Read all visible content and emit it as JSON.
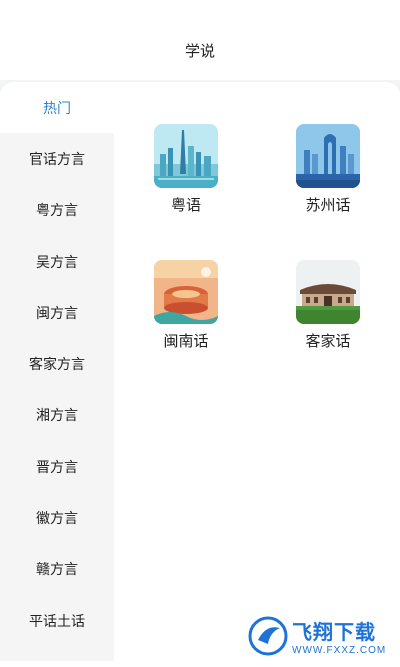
{
  "header": {
    "title": "学说"
  },
  "sidebar": {
    "items": [
      {
        "label": "热门",
        "active": true
      },
      {
        "label": "官话方言",
        "active": false
      },
      {
        "label": "粤方言",
        "active": false
      },
      {
        "label": "吴方言",
        "active": false
      },
      {
        "label": "闽方言",
        "active": false
      },
      {
        "label": "客家方言",
        "active": false
      },
      {
        "label": "湘方言",
        "active": false
      },
      {
        "label": "晋方言",
        "active": false
      },
      {
        "label": "徽方言",
        "active": false
      },
      {
        "label": "赣方言",
        "active": false
      },
      {
        "label": "平话土话",
        "active": false
      }
    ]
  },
  "grid": {
    "items": [
      {
        "label": "粤语",
        "icon": "guangzhou-skyline-image"
      },
      {
        "label": "苏州话",
        "icon": "suzhou-skyline-image"
      },
      {
        "label": "闽南话",
        "icon": "tulou-illustration-image"
      },
      {
        "label": "客家话",
        "icon": "hakka-building-image"
      }
    ]
  },
  "watermark": {
    "main": "飞翔下载",
    "sub": "WWW.FXXZ.COM"
  },
  "colors": {
    "accent": "#2f83d2",
    "sidebar_bg": "#f5f5f5",
    "page_bg": "#f3f4f6"
  }
}
